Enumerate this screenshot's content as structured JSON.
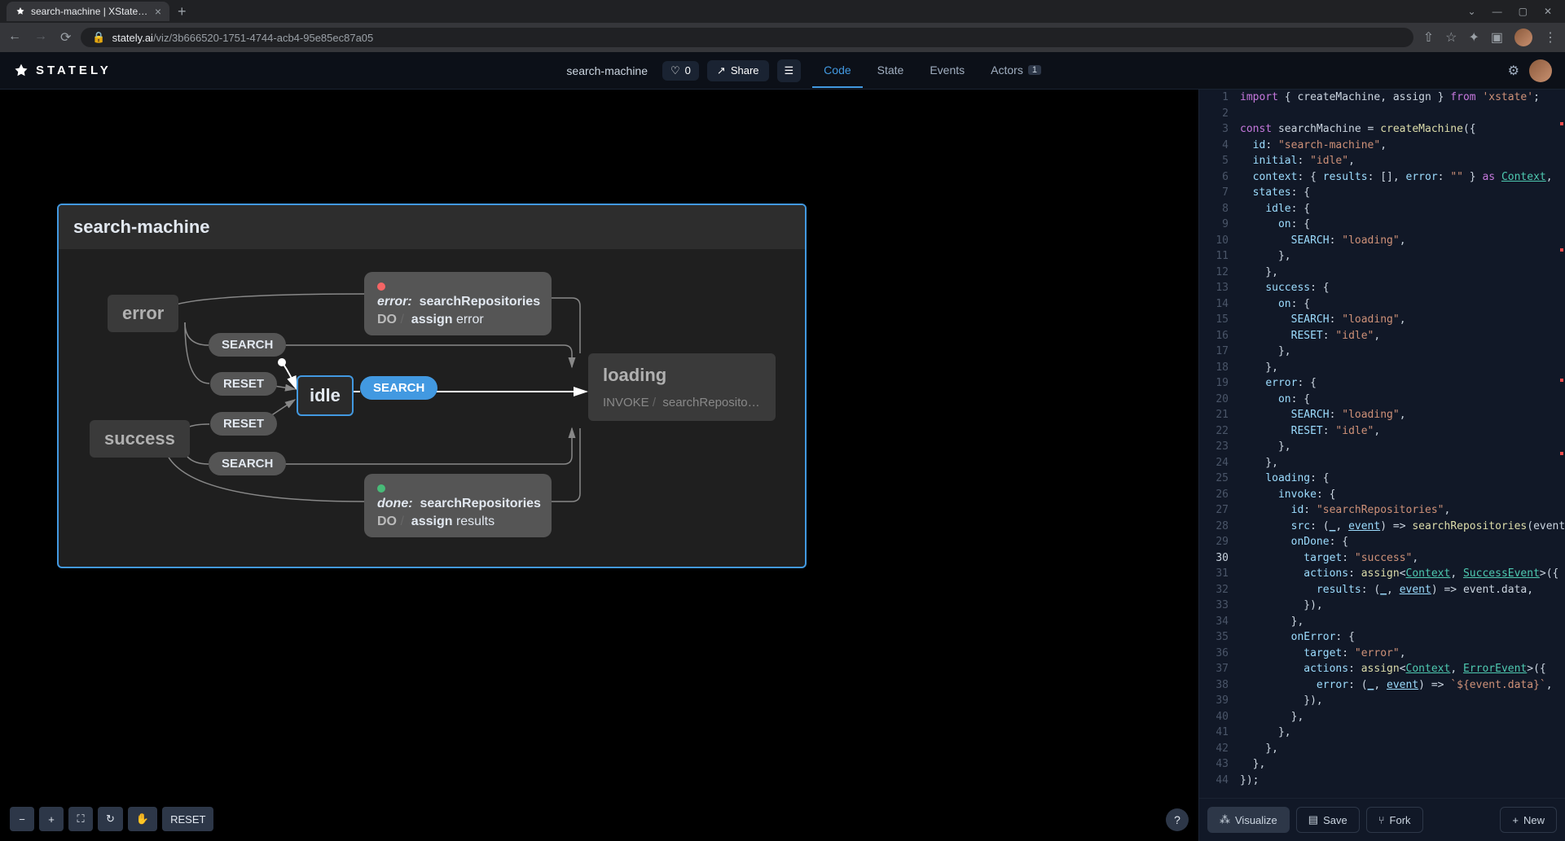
{
  "browser": {
    "tab_title": "search-machine | XState Visualiz",
    "url_domain": "stately.ai",
    "url_path": "/viz/3b666520-1751-4744-acb4-95e85ec87a05"
  },
  "header": {
    "logo": "STATELY",
    "machine_name": "search-machine",
    "like_count": "0",
    "share_label": "Share"
  },
  "tabs": {
    "code": "Code",
    "state": "State",
    "events": "Events",
    "actors": "Actors",
    "actors_count": "1"
  },
  "canvas_controls": {
    "reset": "RESET"
  },
  "machine": {
    "title": "search-machine",
    "states": {
      "idle": "idle",
      "error": "error",
      "success": "success",
      "loading": "loading"
    },
    "loading_invoke_label": "INVOKE",
    "loading_invoke_name": "searchRepositori...",
    "events": {
      "search": "SEARCH",
      "reset": "RESET"
    },
    "action_error": {
      "title": "error:",
      "name": "searchRepositories",
      "do": "DO",
      "assign": "assign",
      "field": "error"
    },
    "action_done": {
      "title": "done:",
      "name": "searchRepositories",
      "do": "DO",
      "assign": "assign",
      "field": "results"
    }
  },
  "code_actions": {
    "visualize": "Visualize",
    "save": "Save",
    "fork": "Fork",
    "new": "New"
  },
  "code_lines": [
    {
      "n": 1,
      "html": "<span class='tk-kw'>import</span> { createMachine, assign } <span class='tk-kw'>from</span> <span class='tk-str'>'xstate'</span>;"
    },
    {
      "n": 2,
      "html": ""
    },
    {
      "n": 3,
      "html": "<span class='tk-kw'>const</span> searchMachine = <span class='tk-fn'>createMachine</span>({"
    },
    {
      "n": 4,
      "html": "  <span class='tk-prop'>id</span>: <span class='tk-str'>\"search-machine\"</span>,"
    },
    {
      "n": 5,
      "html": "  <span class='tk-prop'>initial</span>: <span class='tk-str'>\"idle\"</span>,"
    },
    {
      "n": 6,
      "html": "  <span class='tk-prop'>context</span>: { <span class='tk-prop'>results</span>: [], <span class='tk-prop'>error</span>: <span class='tk-str'>\"\"</span> } <span class='tk-kw'>as</span> <span class='tk-type'>Context</span>,"
    },
    {
      "n": 7,
      "html": "  <span class='tk-prop'>states</span>: {"
    },
    {
      "n": 8,
      "html": "    <span class='tk-prop'>idle</span>: {"
    },
    {
      "n": 9,
      "html": "      <span class='tk-prop'>on</span>: {"
    },
    {
      "n": 10,
      "html": "        <span class='tk-prop'>SEARCH</span>: <span class='tk-str'>\"loading\"</span>,"
    },
    {
      "n": 11,
      "html": "      },"
    },
    {
      "n": 12,
      "html": "    },"
    },
    {
      "n": 13,
      "html": "    <span class='tk-prop'>success</span>: {"
    },
    {
      "n": 14,
      "html": "      <span class='tk-prop'>on</span>: {"
    },
    {
      "n": 15,
      "html": "        <span class='tk-prop'>SEARCH</span>: <span class='tk-str'>\"loading\"</span>,"
    },
    {
      "n": 16,
      "html": "        <span class='tk-prop'>RESET</span>: <span class='tk-str'>\"idle\"</span>,"
    },
    {
      "n": 17,
      "html": "      },"
    },
    {
      "n": 18,
      "html": "    },"
    },
    {
      "n": 19,
      "html": "    <span class='tk-prop'>error</span>: {"
    },
    {
      "n": 20,
      "html": "      <span class='tk-prop'>on</span>: {"
    },
    {
      "n": 21,
      "html": "        <span class='tk-prop'>SEARCH</span>: <span class='tk-str'>\"loading\"</span>,"
    },
    {
      "n": 22,
      "html": "        <span class='tk-prop'>RESET</span>: <span class='tk-str'>\"idle\"</span>,"
    },
    {
      "n": 23,
      "html": "      },"
    },
    {
      "n": 24,
      "html": "    },"
    },
    {
      "n": 25,
      "html": "    <span class='tk-prop'>loading</span>: {"
    },
    {
      "n": 26,
      "html": "      <span class='tk-prop'>invoke</span>: {"
    },
    {
      "n": 27,
      "html": "        <span class='tk-prop'>id</span>: <span class='tk-str'>\"searchRepositories\"</span>,"
    },
    {
      "n": 28,
      "html": "        <span class='tk-prop'>src</span>: (<span class='tk-param'>_</span>, <span class='tk-param'>event</span>) =&gt; <span class='tk-fn error-squiggle'>searchRepositories</span>(event.data),"
    },
    {
      "n": 29,
      "html": "        <span class='tk-prop'>onDone</span>: <span class='error-squiggle'>{</span>"
    },
    {
      "n": 30,
      "active": true,
      "html": "          <span class='tk-prop'>target</span>: <span class='tk-str'>\"success\"</span>,"
    },
    {
      "n": 31,
      "html": "          <span class='tk-prop'>actions</span>: <span class='tk-fn'>assign</span>&lt;<span class='tk-type'>Context</span>, <span class='tk-type'>SuccessEvent</span>&gt;({"
    },
    {
      "n": 32,
      "html": "            <span class='tk-prop'>results</span>: (<span class='tk-param'>_</span>, <span class='tk-param'>event</span>) =&gt; event.data,"
    },
    {
      "n": 33,
      "html": "          }),"
    },
    {
      "n": 34,
      "html": "        <span class='error-squiggle'>}</span>,"
    },
    {
      "n": 35,
      "html": "        <span class='tk-prop'>onError</span>: {"
    },
    {
      "n": 36,
      "html": "          <span class='tk-prop'>target</span>: <span class='tk-str'>\"error\"</span>,"
    },
    {
      "n": 37,
      "html": "          <span class='tk-prop'>actions</span>: <span class='tk-fn'>assign</span>&lt;<span class='tk-type'>Context</span>, <span class='tk-type'>ErrorEvent</span>&gt;({"
    },
    {
      "n": 38,
      "html": "            <span class='tk-prop'>error</span>: (<span class='tk-param'>_</span>, <span class='tk-param'>event</span>) =&gt; <span class='tk-str'>`${event.data}`</span>,"
    },
    {
      "n": 39,
      "html": "          }),"
    },
    {
      "n": 40,
      "html": "        },"
    },
    {
      "n": 41,
      "html": "      },"
    },
    {
      "n": 42,
      "html": "    },"
    },
    {
      "n": 43,
      "html": "  },"
    },
    {
      "n": 44,
      "html": "});"
    }
  ]
}
